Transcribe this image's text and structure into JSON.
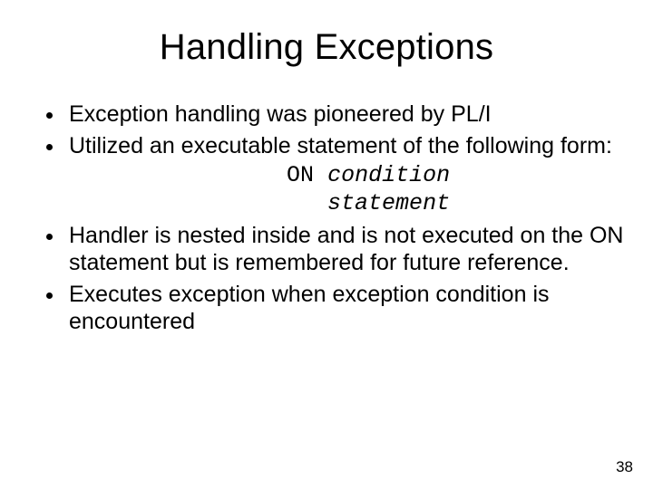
{
  "title": "Handling Exceptions",
  "bullets": {
    "b1": "Exception handling was pioneered by PL/I",
    "b2": "Utilized an executable statement of the following form:",
    "b3": "Handler is nested inside and is not executed on the ON statement but is remembered for future reference.",
    "b4": "Executes exception when exception condition is encountered"
  },
  "code": {
    "indent1": "                ",
    "kw": "ON ",
    "arg1": "condition",
    "indent2": "                   ",
    "arg2": "statement"
  },
  "page_number": "38"
}
